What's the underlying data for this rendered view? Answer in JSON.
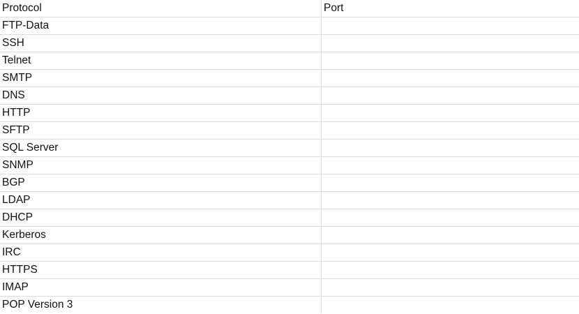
{
  "table": {
    "headers": {
      "protocol": "Protocol",
      "port": "Port"
    },
    "rows": [
      {
        "protocol": "FTP-Data",
        "port": ""
      },
      {
        "protocol": "SSH",
        "port": ""
      },
      {
        "protocol": "Telnet",
        "port": ""
      },
      {
        "protocol": "SMTP",
        "port": ""
      },
      {
        "protocol": "DNS",
        "port": ""
      },
      {
        "protocol": "HTTP",
        "port": ""
      },
      {
        "protocol": "SFTP",
        "port": ""
      },
      {
        "protocol": "SQL Server",
        "port": ""
      },
      {
        "protocol": "SNMP",
        "port": ""
      },
      {
        "protocol": "BGP",
        "port": ""
      },
      {
        "protocol": "LDAP",
        "port": ""
      },
      {
        "protocol": "DHCP",
        "port": ""
      },
      {
        "protocol": "Kerberos",
        "port": ""
      },
      {
        "protocol": "IRC",
        "port": ""
      },
      {
        "protocol": "HTTPS",
        "port": ""
      },
      {
        "protocol": "IMAP",
        "port": ""
      },
      {
        "protocol": "POP Version 3",
        "port": ""
      }
    ]
  }
}
